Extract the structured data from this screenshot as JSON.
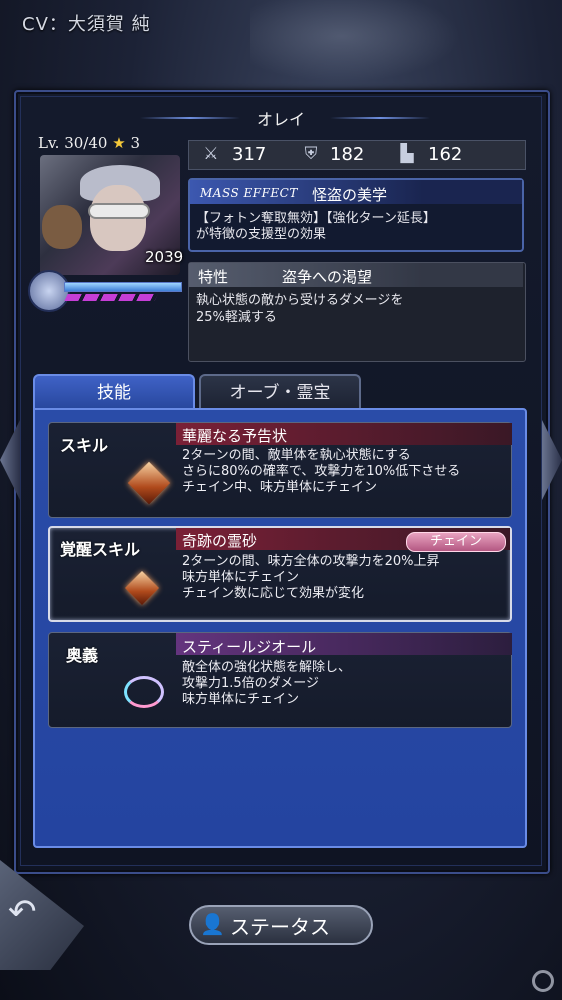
{
  "header": {
    "cv": "CV：大須賀 純"
  },
  "character": {
    "name": "オレイ",
    "level_text": "Lv. 30/40",
    "stars": "3",
    "power": "2039",
    "hp_fraction": 1.0
  },
  "stats": [
    {
      "icon": "sword-icon",
      "value": "317"
    },
    {
      "icon": "shield-icon",
      "value": "182"
    },
    {
      "icon": "boot-icon",
      "value": "162"
    }
  ],
  "mass_effect": {
    "tag": "MASS EFFECT",
    "title": "怪盗の美学",
    "desc_line1": "【フォトン奪取無効】【強化ターン延長】",
    "desc_line2": "が特徴の支援型の効果"
  },
  "trait": {
    "tag": "特性",
    "title": "盗争への渇望",
    "desc_line1": "執心状態の敵から受けるダメージを",
    "desc_line2": "25%軽減する"
  },
  "tabs": {
    "active": "技能",
    "inactive": "オーブ・霊宝"
  },
  "skills": [
    {
      "label": "スキル",
      "title": "華麗なる予告状",
      "lines": [
        "2ターンの間、敵単体を執心状態にする",
        "さらに80%の確率で、攻撃力を10%低下させる",
        "チェイン中、味方単体にチェイン"
      ]
    },
    {
      "label": "覚醒スキル",
      "title": "奇跡の霊砂",
      "badge": "チェイン",
      "lines": [
        "2ターンの間、味方全体の攻撃力を20%上昇",
        "味方単体にチェイン",
        "チェイン数に応じて効果が変化"
      ]
    },
    {
      "label": "奥義",
      "title": "スティールジオール",
      "lines": [
        "敵全体の強化状態を解除し、",
        "攻撃力1.5倍のダメージ",
        "味方単体にチェイン"
      ]
    }
  ],
  "footer": {
    "status_label": "ステータス"
  },
  "colors": {
    "accent": "#3f62c6",
    "skill_bar": "#7a2036",
    "ougi_bar": "#64347e",
    "chain_badge": "#b45882"
  }
}
